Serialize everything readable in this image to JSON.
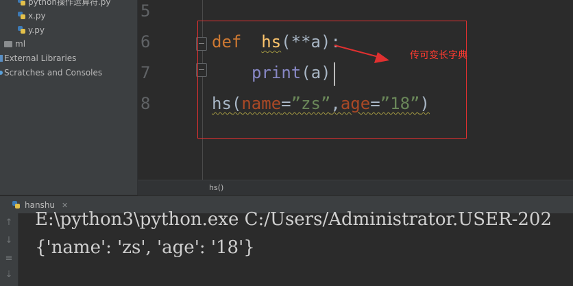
{
  "project_tree": {
    "items": [
      {
        "label": "python操作运算符.py",
        "icon": "python-file-icon"
      },
      {
        "label": "x.py",
        "icon": "python-file-icon"
      },
      {
        "label": "y.py",
        "icon": "python-file-icon"
      },
      {
        "label": "ml",
        "icon": "folder-icon"
      },
      {
        "label": "External Libraries",
        "icon": "library-icon"
      },
      {
        "label": "Scratches and Consoles",
        "icon": "scratches-icon"
      }
    ]
  },
  "editor": {
    "line_numbers": [
      "5",
      "6",
      "7",
      "8"
    ],
    "line6": {
      "kw": "def",
      "fn": "hs",
      "p1": "(",
      "op": "**",
      "param": "a",
      "p2": ")",
      "colon": ":"
    },
    "line7": {
      "builtin": "print",
      "args": "(a)"
    },
    "line8": {
      "fn": "hs",
      "p1": "(",
      "k1": "name",
      "eq1": "=",
      "v1": "”zs”",
      "comma": ",",
      "k2": "age",
      "eq2": "=",
      "v2": "”18”",
      "p2": ")"
    },
    "breadcrumb": "hs()"
  },
  "annotation": {
    "text": "传可变长字典",
    "color": "#ff3b30"
  },
  "run_panel": {
    "tab_label": "hanshu",
    "output": [
      "E:\\python3\\python.exe C:/Users/Administrator.USER-202",
      "{'name': 'zs', 'age': '18'}"
    ]
  },
  "colors": {
    "keyword": "#cc7832",
    "function": "#ffc66d",
    "builtin": "#8888c6",
    "param": "#aa4926",
    "string": "#6a8759",
    "background": "#2b2b2b"
  }
}
